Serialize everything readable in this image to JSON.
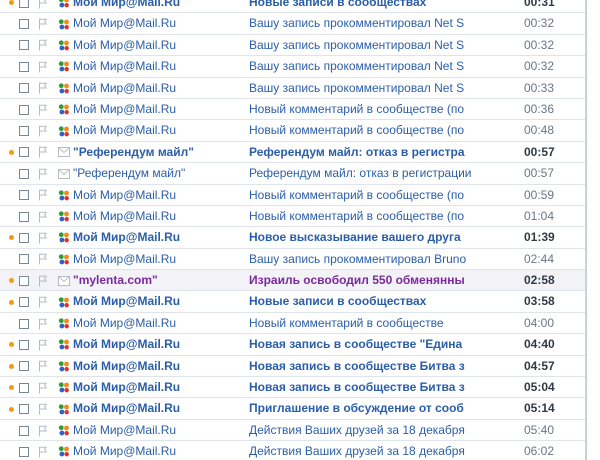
{
  "colors": {
    "link_blue": "#2b5ea8",
    "selected_purple": "#7a2a9a",
    "unread_dot": "#f09a1c",
    "row_border": "#dfe3ea",
    "selected_bg": "#f2f2f7"
  },
  "icons": {
    "flag": "flag-outline-icon",
    "mymir": "mymir-people-icon",
    "letter": "letter-icon"
  },
  "messages": [
    {
      "sender": "Мой Мир@Mail.Ru",
      "subject": "Новые записи в сообществах",
      "time": "00:31",
      "unread": true,
      "selected": false,
      "icon": "mymir"
    },
    {
      "sender": "Мой Мир@Mail.Ru",
      "subject": "Вашу запись прокомментировал Net S",
      "time": "00:32",
      "unread": false,
      "selected": false,
      "icon": "mymir"
    },
    {
      "sender": "Мой Мир@Mail.Ru",
      "subject": "Вашу запись прокомментировал Net S",
      "time": "00:32",
      "unread": false,
      "selected": false,
      "icon": "mymir"
    },
    {
      "sender": "Мой Мир@Mail.Ru",
      "subject": "Вашу запись прокомментировал Net S",
      "time": "00:32",
      "unread": false,
      "selected": false,
      "icon": "mymir"
    },
    {
      "sender": "Мой Мир@Mail.Ru",
      "subject": "Вашу запись прокомментировал Net S",
      "time": "00:33",
      "unread": false,
      "selected": false,
      "icon": "mymir"
    },
    {
      "sender": "Мой Мир@Mail.Ru",
      "subject": "Новый комментарий в сообществе (по",
      "time": "00:36",
      "unread": false,
      "selected": false,
      "icon": "mymir"
    },
    {
      "sender": "Мой Мир@Mail.Ru",
      "subject": "Новый комментарий в сообществе (по",
      "time": "00:48",
      "unread": false,
      "selected": false,
      "icon": "mymir"
    },
    {
      "sender": "\"Референдум майл\"",
      "subject": "Референдум майл: отказ в регистра",
      "time": "00:57",
      "unread": true,
      "selected": false,
      "icon": "letter"
    },
    {
      "sender": "\"Референдум майл\"",
      "subject": "Референдум майл: отказ в регистрации",
      "time": "00:57",
      "unread": false,
      "selected": false,
      "icon": "letter"
    },
    {
      "sender": "Мой Мир@Mail.Ru",
      "subject": "Новый комментарий в сообществе (по",
      "time": "00:59",
      "unread": false,
      "selected": false,
      "icon": "mymir"
    },
    {
      "sender": "Мой Мир@Mail.Ru",
      "subject": "Новый комментарий в сообществе (по",
      "time": "01:04",
      "unread": false,
      "selected": false,
      "icon": "mymir"
    },
    {
      "sender": "Мой Мир@Mail.Ru",
      "subject": "Новое высказывание вашего друга",
      "time": "01:39",
      "unread": true,
      "selected": false,
      "icon": "mymir"
    },
    {
      "sender": "Мой Мир@Mail.Ru",
      "subject": "Вашу запись прокомментировал Bruno",
      "time": "02:44",
      "unread": false,
      "selected": false,
      "icon": "mymir"
    },
    {
      "sender": "\"mylenta.com\"",
      "subject": "Израиль освободил 550 обменянны",
      "time": "02:58",
      "unread": true,
      "selected": true,
      "icon": "letter"
    },
    {
      "sender": "Мой Мир@Mail.Ru",
      "subject": "Новые записи в сообществах",
      "time": "03:58",
      "unread": true,
      "selected": false,
      "icon": "mymir"
    },
    {
      "sender": "Мой Мир@Mail.Ru",
      "subject": "Новый комментарий в сообществе",
      "time": "04:00",
      "unread": false,
      "selected": false,
      "icon": "mymir"
    },
    {
      "sender": "Мой Мир@Mail.Ru",
      "subject": "Новая запись в сообществе \"Едина",
      "time": "04:40",
      "unread": true,
      "selected": false,
      "icon": "mymir"
    },
    {
      "sender": "Мой Мир@Mail.Ru",
      "subject": "Новая запись в сообществе Битва з",
      "time": "04:57",
      "unread": true,
      "selected": false,
      "icon": "mymir"
    },
    {
      "sender": "Мой Мир@Mail.Ru",
      "subject": "Новая запись в сообществе Битва з",
      "time": "05:04",
      "unread": true,
      "selected": false,
      "icon": "mymir"
    },
    {
      "sender": "Мой Мир@Mail.Ru",
      "subject": "Приглашение в обсуждение от сооб",
      "time": "05:14",
      "unread": true,
      "selected": false,
      "icon": "mymir"
    },
    {
      "sender": "Мой Мир@Mail.Ru",
      "subject": "Действия Ваших друзей за 18 декабря",
      "time": "05:40",
      "unread": false,
      "selected": false,
      "icon": "mymir"
    },
    {
      "sender": "Мой Мир@Mail.Ru",
      "subject": "Действия Ваших друзей за 18 декабря",
      "time": "06:02",
      "unread": false,
      "selected": false,
      "icon": "mymir"
    }
  ]
}
